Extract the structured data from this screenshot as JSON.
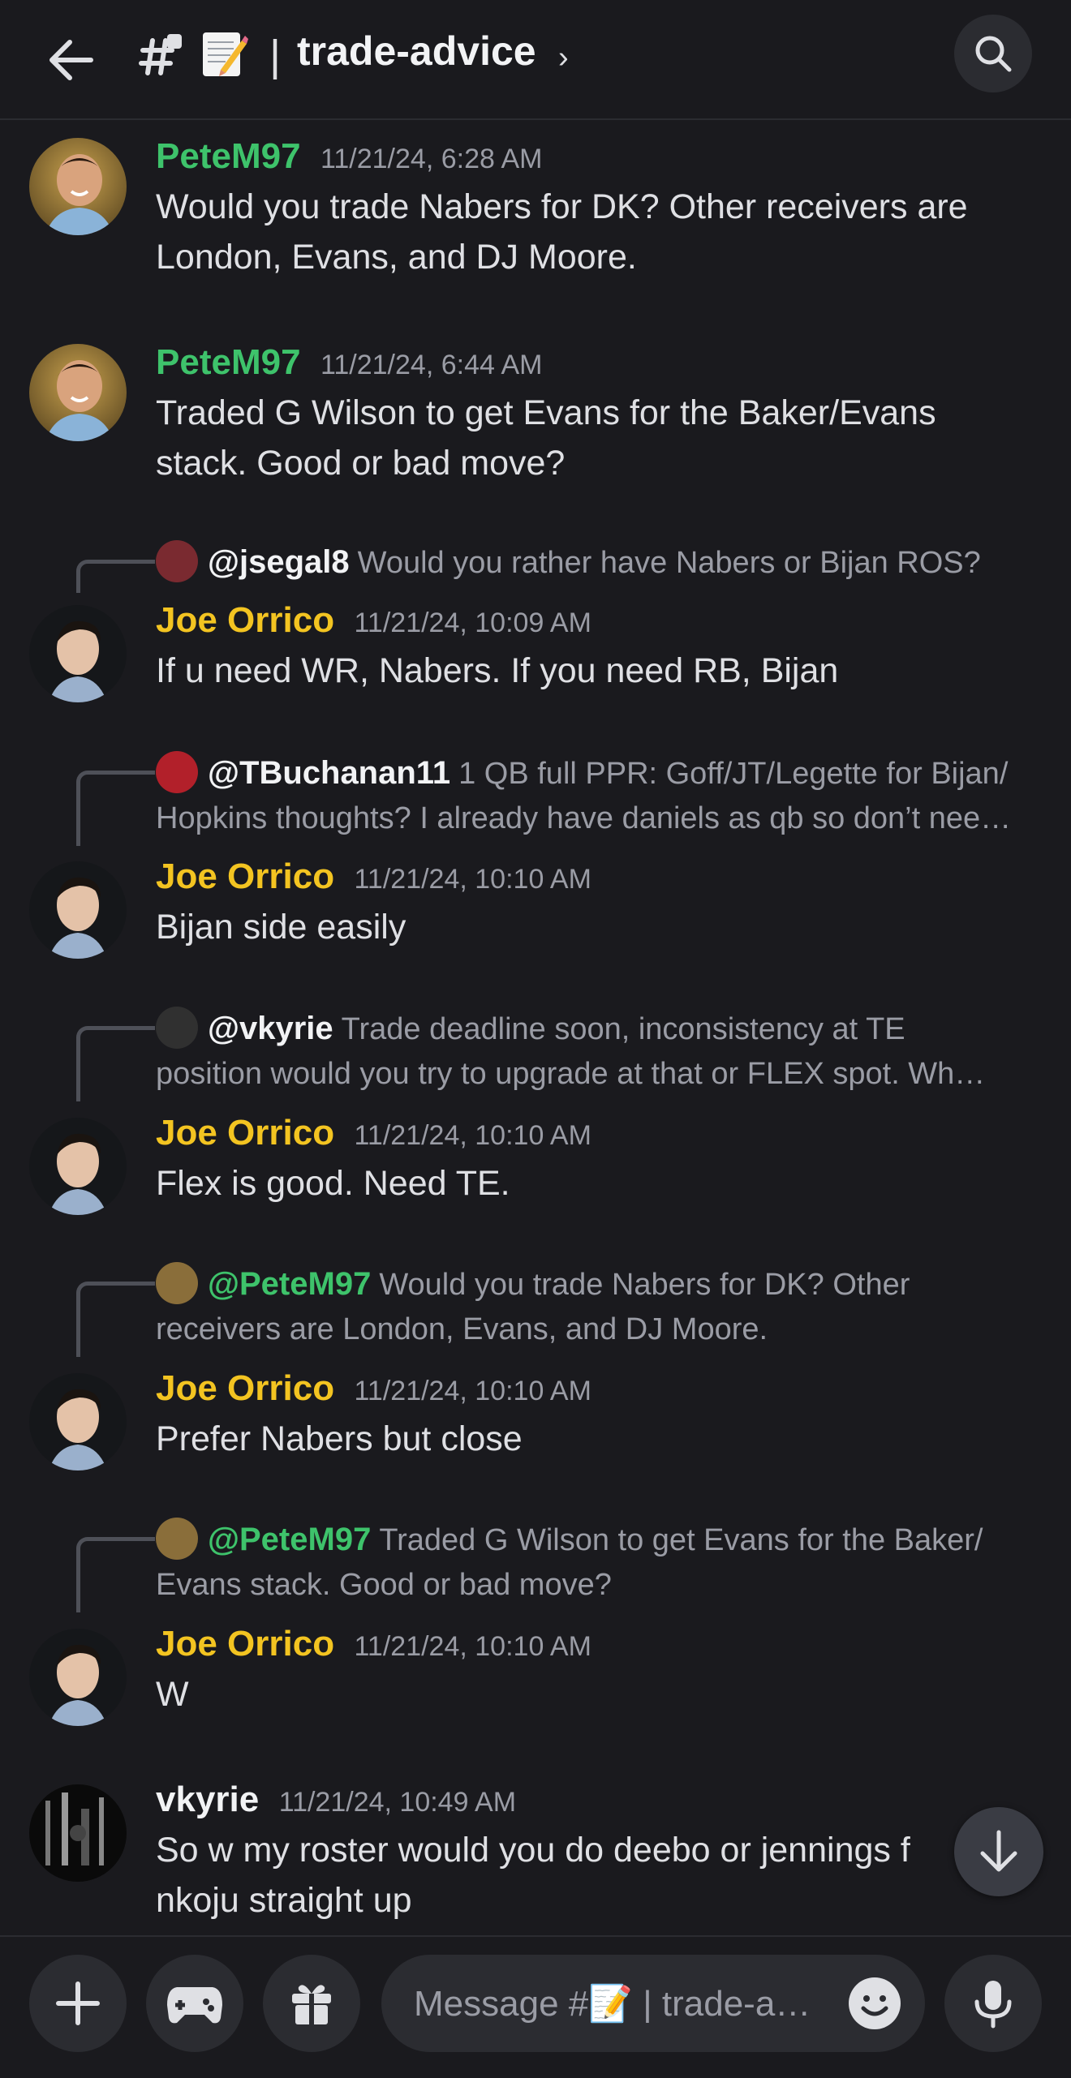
{
  "header": {
    "channel_emoji": "📝",
    "separator": "|",
    "channel_name": "trade-advice",
    "chevron": "›"
  },
  "messages": [
    {
      "author": "PeteM97",
      "timestamp": "11/21/24, 6:28 AM",
      "text": "Would you trade Nabers for DK? Other receivers are London, Evans, and DJ Moore."
    },
    {
      "author": "PeteM97",
      "timestamp": "11/21/24, 6:44 AM",
      "text": "Traded G Wilson to get Evans for the Baker/Evans stack. Good or bad move?"
    },
    {
      "reply_to": "@jsegal8",
      "reply_text": "Would you rather have Nabers or Bijan ROS?",
      "author": "Joe Orrico",
      "timestamp": "11/21/24, 10:09 AM",
      "text": "If u need WR, Nabers. If you need RB, Bijan"
    },
    {
      "reply_to": "@TBuchanan11",
      "reply_text": "1 QB full PPR: Goff/JT/Legette for Bijan/",
      "reply_text2": "Hopkins thoughts? I already have daniels as qb so don’t nee…",
      "author": "Joe Orrico",
      "timestamp": "11/21/24, 10:10 AM",
      "text": "Bijan side easily"
    },
    {
      "reply_to": "@vkyrie",
      "reply_text": "Trade deadline soon, inconsistency at TE",
      "reply_text2": "position would you try to upgrade at that or FLEX spot. Wh…",
      "author": "Joe Orrico",
      "timestamp": "11/21/24, 10:10 AM",
      "text": "Flex is good. Need TE."
    },
    {
      "reply_to": "@PeteM97",
      "reply_text": "Would you trade Nabers for DK? Other",
      "reply_text2": "receivers are London, Evans, and DJ Moore.",
      "author": "Joe Orrico",
      "timestamp": "11/21/24, 10:10 AM",
      "text": "Prefer Nabers but close"
    },
    {
      "reply_to": "@PeteM97",
      "reply_text": "Traded G Wilson to get Evans for the Baker/",
      "reply_text2": "Evans stack. Good or bad move?",
      "author": "Joe Orrico",
      "timestamp": "11/21/24, 10:10 AM",
      "text": "W"
    },
    {
      "author": "vkyrie",
      "timestamp": "11/21/24, 10:49 AM",
      "text": "So w my roster would you do deebo or jennings f",
      "text2": "nkoju straight up"
    }
  ],
  "composer": {
    "placeholder": "Message #📝 | trade-a…"
  },
  "colors": {
    "background": "#1a1a1e",
    "pete_name": "#3ec36b",
    "joe_name": "#f3c421",
    "vkyrie_name": "#f2f3f5"
  }
}
